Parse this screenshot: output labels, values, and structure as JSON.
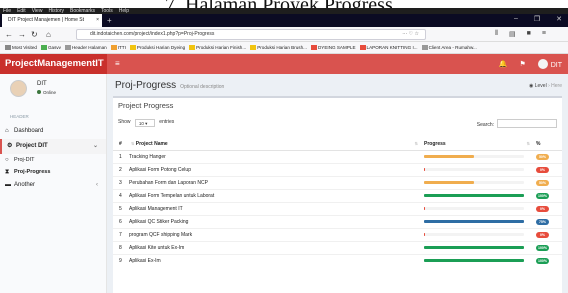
{
  "caption": "7. Halaman Proyek Progress",
  "browser": {
    "menu": [
      "File",
      "Edit",
      "View",
      "History",
      "Bookmarks",
      "Tools",
      "Help"
    ],
    "tab_title": "DIT Project Manajemen | Home St",
    "tab_close": "×",
    "new_tab": "+",
    "window_controls": [
      "–",
      "❐",
      "✕"
    ],
    "url": "dit.indotaichen.com/project/index1.php?p=Proj-Progress",
    "url_more": "··· ♡ ☆",
    "bookmarks": [
      {
        "label": "Most Visited",
        "color": "#888"
      },
      {
        "label": "Gasvv",
        "color": "#4caf50"
      },
      {
        "label": "Header Halaman",
        "color": "#999"
      },
      {
        "label": "ITTI",
        "color": "#f0a030"
      },
      {
        "label": "Produksi Harian Dyeing",
        "color": "#f1c40f"
      },
      {
        "label": "Produksi Harian Finish...",
        "color": "#f1c40f"
      },
      {
        "label": "Produksi Harian Brush...",
        "color": "#f1c40f"
      },
      {
        "label": "DYEING SAMPLE",
        "color": "#e74c3c"
      },
      {
        "label": "LAPORAN KNITTING I...",
        "color": "#e74c3c"
      },
      {
        "label": "Client Area - Rumahw...",
        "color": "#999"
      }
    ]
  },
  "app": {
    "brand": "ProjectManagementIT",
    "menu_icon": "≡",
    "user_label": "DIT",
    "header_color": "#d9534f"
  },
  "sidebar": {
    "user_name": "DIT",
    "user_status": "Online",
    "section": "HEADER",
    "items": [
      {
        "label": "Dashboard",
        "icon": "⌂"
      },
      {
        "label": "Project DIT",
        "icon": "⚙",
        "caret": "⌄"
      },
      {
        "label": "Proj-DIT",
        "icon": "○"
      },
      {
        "label": "Proj-Progress",
        "icon": "⧗"
      },
      {
        "label": "Another",
        "icon": "▬",
        "caret": "‹"
      }
    ]
  },
  "page": {
    "title": "Proj-Progress",
    "subtitle": "Optional description",
    "breadcrumb_level": "Level",
    "breadcrumb_here": "Here",
    "box_title": "Project Progress",
    "show_label": "Show",
    "entries_value": "10",
    "entries_label": "entries",
    "search_label": "Search:"
  },
  "table": {
    "headers": [
      "#",
      "Project Name",
      "Progress",
      "%"
    ],
    "rows": [
      {
        "no": "1",
        "name": "Tracking Hanger",
        "pct": "50%",
        "value": 50,
        "color": "#f0ad4e"
      },
      {
        "no": "2",
        "name": "Aplikasi Form Potong Celup",
        "pct": "0%",
        "value": 1,
        "color": "#e74c3c"
      },
      {
        "no": "3",
        "name": "Perubahan Form dan Laporan NCP",
        "pct": "50%",
        "value": 50,
        "color": "#f0ad4e"
      },
      {
        "no": "4",
        "name": "Aplikasi Form Tempelan untuk Laborat",
        "pct": "100%",
        "value": 100,
        "color": "#1b9e55"
      },
      {
        "no": "5",
        "name": "Aplikasi Management IT",
        "pct": "0%",
        "value": 1,
        "color": "#e74c3c"
      },
      {
        "no": "6",
        "name": "Aplikasi QC Stiker Packing",
        "pct": "75%",
        "value": 100,
        "color": "#2e6da4"
      },
      {
        "no": "7",
        "name": "program QCF shipping Mark",
        "pct": "0%",
        "value": 1,
        "color": "#e74c3c"
      },
      {
        "no": "8",
        "name": "Aplikasi Kite untuk Ex-Im",
        "pct": "100%",
        "value": 100,
        "color": "#1b9e55"
      },
      {
        "no": "9",
        "name": "Aplikasi Ex-Im",
        "pct": "100%",
        "value": 100,
        "color": "#1b9e55"
      }
    ]
  }
}
